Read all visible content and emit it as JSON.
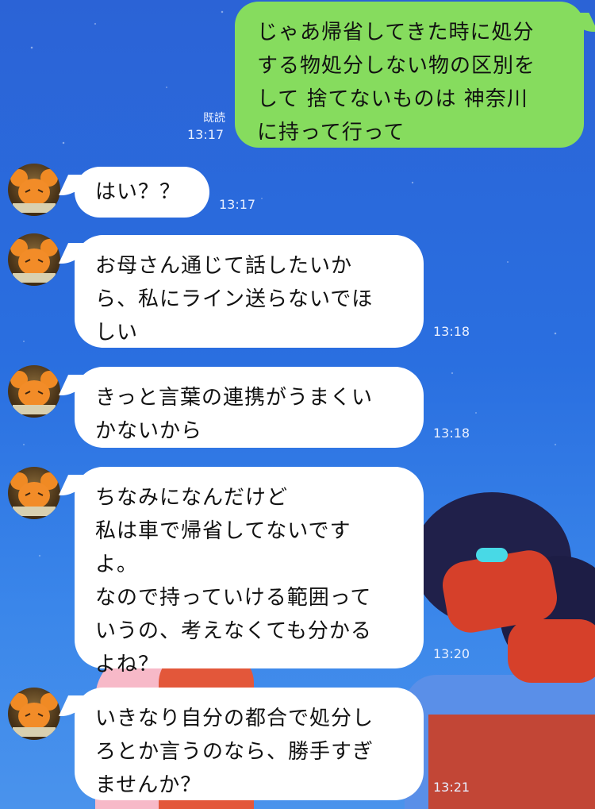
{
  "colors": {
    "background": "#2a6fe0",
    "outgoing_bubble": "#86dc5e",
    "incoming_bubble": "#ffffff",
    "meta_text": "#e8efff"
  },
  "contact": {
    "avatar_icon": "dedenne-avatar-icon"
  },
  "messages": [
    {
      "direction": "outgoing",
      "text": "じゃあ帰省してきた時に処分\nする物処分しない物の区別を\nして 捨てないものは 神奈川\nに持って行って",
      "read": "既読",
      "time": "13:17"
    },
    {
      "direction": "incoming",
      "text": "はい？？",
      "time": "13:17"
    },
    {
      "direction": "incoming",
      "text": "お母さん通じて話したいか\nら、私にライン送らないでほ\nしい",
      "time": "13:18"
    },
    {
      "direction": "incoming",
      "text": "きっと言葉の連携がうまくい\nかないから",
      "time": "13:18"
    },
    {
      "direction": "incoming",
      "text": "ちなみになんだけど\n私は車で帰省してないです\nよ。\nなので持っていける範囲って\nいうの、考えなくても分かる\nよね？",
      "time": "13:20"
    },
    {
      "direction": "incoming",
      "text": "いきなり自分の都合で処分し\nろとか言うのなら、勝手すぎ\nませんか？",
      "time": "13:21"
    }
  ]
}
